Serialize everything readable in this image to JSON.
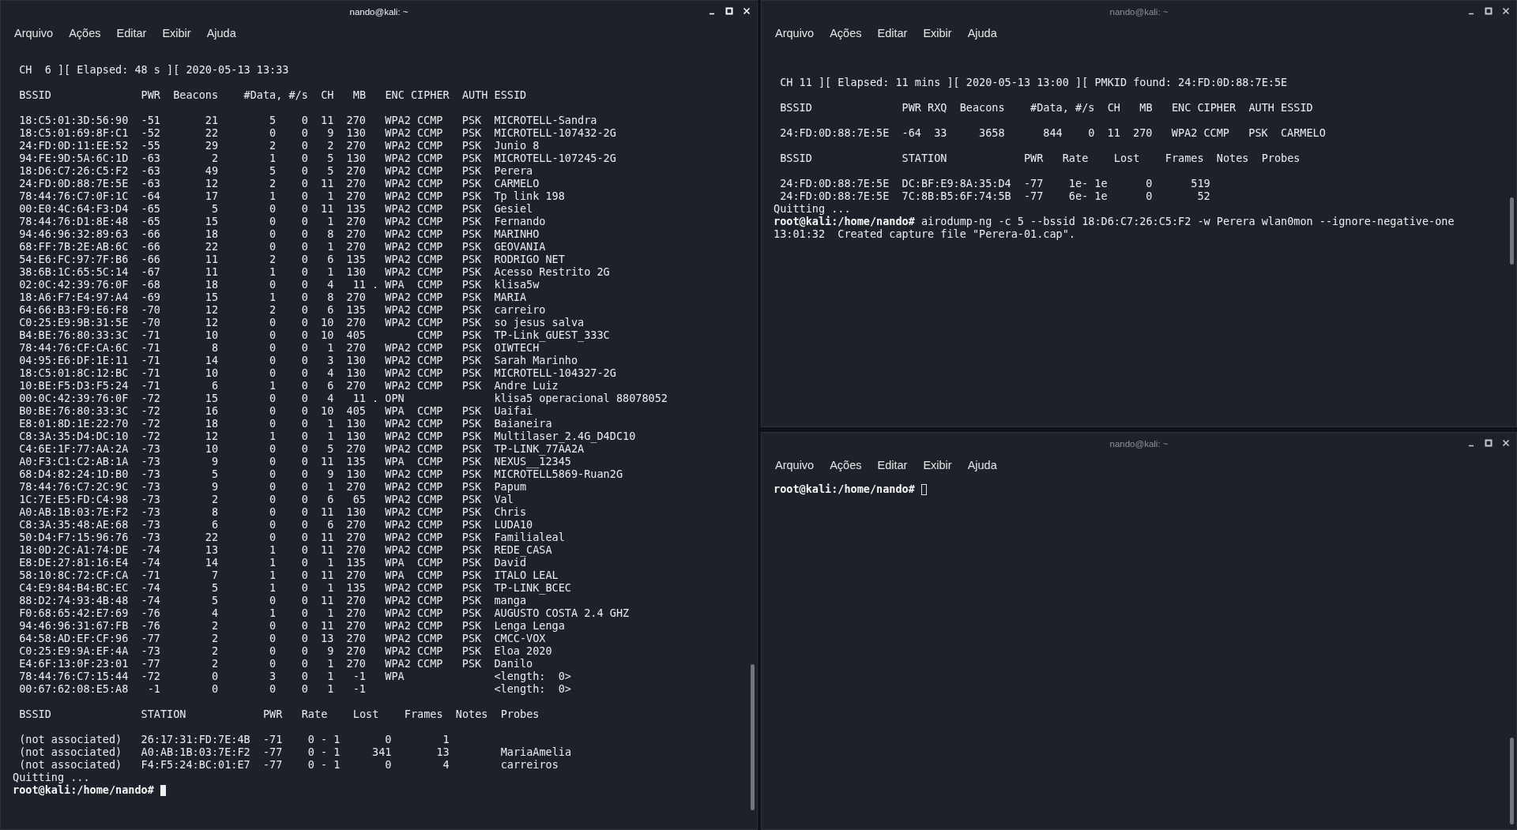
{
  "windows": [
    {
      "title": "nando@kali: ~",
      "focused": true,
      "menu": [
        "Arquivo",
        "Ações",
        "Editar",
        "Exibir",
        "Ajuda"
      ],
      "lines": [
        {
          "kind": "blank"
        },
        {
          "kind": "text",
          "text": " CH  6 ][ Elapsed: 48 s ][ 2020-05-13 13:33"
        },
        {
          "kind": "blank"
        },
        {
          "kind": "text",
          "text": " BSSID              PWR  Beacons    #Data, #/s  CH   MB   ENC CIPHER  AUTH ESSID"
        },
        {
          "kind": "blank"
        },
        {
          "kind": "ap",
          "bssid": "18:C5:01:3D:56:90",
          "pwr": "-51",
          "beacons": "21",
          "data": "5",
          "rate": "0",
          "ch": "11",
          "mb": "270",
          "enc": "WPA2",
          "cipher": "CCMP",
          "auth": "PSK",
          "essid": "MICROTELL-Sandra"
        },
        {
          "kind": "ap",
          "bssid": "18:C5:01:69:8F:C1",
          "pwr": "-52",
          "beacons": "22",
          "data": "0",
          "rate": "0",
          "ch": "9",
          "mb": "130",
          "enc": "WPA2",
          "cipher": "CCMP",
          "auth": "PSK",
          "essid": "MICROTELL-107432-2G"
        },
        {
          "kind": "ap",
          "bssid": "24:FD:0D:11:EE:52",
          "pwr": "-55",
          "beacons": "29",
          "data": "2",
          "rate": "0",
          "ch": "2",
          "mb": "270",
          "enc": "WPA2",
          "cipher": "CCMP",
          "auth": "PSK",
          "essid": "Junio 8"
        },
        {
          "kind": "ap",
          "bssid": "94:FE:9D:5A:6C:1D",
          "pwr": "-63",
          "beacons": "2",
          "data": "1",
          "rate": "0",
          "ch": "5",
          "mb": "130",
          "enc": "WPA2",
          "cipher": "CCMP",
          "auth": "PSK",
          "essid": "MICROTELL-107245-2G"
        },
        {
          "kind": "ap",
          "bssid": "18:D6:C7:26:C5:F2",
          "pwr": "-63",
          "beacons": "49",
          "data": "5",
          "rate": "0",
          "ch": "5",
          "mb": "270",
          "enc": "WPA2",
          "cipher": "CCMP",
          "auth": "PSK",
          "essid": "Perera"
        },
        {
          "kind": "ap",
          "bssid": "24:FD:0D:88:7E:5E",
          "pwr": "-63",
          "beacons": "12",
          "data": "2",
          "rate": "0",
          "ch": "11",
          "mb": "270",
          "enc": "WPA2",
          "cipher": "CCMP",
          "auth": "PSK",
          "essid": "CARMELO"
        },
        {
          "kind": "ap",
          "bssid": "78:44:76:C7:0F:1C",
          "pwr": "-64",
          "beacons": "17",
          "data": "1",
          "rate": "0",
          "ch": "1",
          "mb": "270",
          "enc": "WPA2",
          "cipher": "CCMP",
          "auth": "PSK",
          "essid": "Tp link 198"
        },
        {
          "kind": "ap",
          "bssid": "00:E0:4C:64:F3:D4",
          "pwr": "-65",
          "beacons": "5",
          "data": "0",
          "rate": "0",
          "ch": "11",
          "mb": "135",
          "enc": "WPA2",
          "cipher": "CCMP",
          "auth": "PSK",
          "essid": "Gesiel"
        },
        {
          "kind": "ap",
          "bssid": "78:44:76:D1:8E:48",
          "pwr": "-65",
          "beacons": "15",
          "data": "0",
          "rate": "0",
          "ch": "1",
          "mb": "270",
          "enc": "WPA2",
          "cipher": "CCMP",
          "auth": "PSK",
          "essid": "Fernando"
        },
        {
          "kind": "ap",
          "bssid": "94:46:96:32:89:63",
          "pwr": "-66",
          "beacons": "18",
          "data": "0",
          "rate": "0",
          "ch": "8",
          "mb": "270",
          "enc": "WPA2",
          "cipher": "CCMP",
          "auth": "PSK",
          "essid": "MARINHO"
        },
        {
          "kind": "ap",
          "bssid": "68:FF:7B:2E:AB:6C",
          "pwr": "-66",
          "beacons": "22",
          "data": "0",
          "rate": "0",
          "ch": "1",
          "mb": "270",
          "enc": "WPA2",
          "cipher": "CCMP",
          "auth": "PSK",
          "essid": "GEOVANIA"
        },
        {
          "kind": "ap",
          "bssid": "54:E6:FC:97:7F:B6",
          "pwr": "-66",
          "beacons": "11",
          "data": "2",
          "rate": "0",
          "ch": "6",
          "mb": "135",
          "enc": "WPA2",
          "cipher": "CCMP",
          "auth": "PSK",
          "essid": "RODRIGO NET"
        },
        {
          "kind": "ap",
          "bssid": "38:6B:1C:65:5C:14",
          "pwr": "-67",
          "beacons": "11",
          "data": "1",
          "rate": "0",
          "ch": "1",
          "mb": "130",
          "enc": "WPA2",
          "cipher": "CCMP",
          "auth": "PSK",
          "essid": "Acesso Restrito 2G"
        },
        {
          "kind": "ap",
          "bssid": "02:0C:42:39:76:0F",
          "pwr": "-68",
          "beacons": "18",
          "data": "0",
          "rate": "0",
          "ch": "4",
          "mb": "11",
          "flag": ".",
          "enc": "WPA",
          "cipher": "CCMP",
          "auth": "PSK",
          "essid": "klisa5w"
        },
        {
          "kind": "ap",
          "bssid": "18:A6:F7:E4:97:A4",
          "pwr": "-69",
          "beacons": "15",
          "data": "1",
          "rate": "0",
          "ch": "8",
          "mb": "270",
          "enc": "WPA2",
          "cipher": "CCMP",
          "auth": "PSK",
          "essid": "MARIA"
        },
        {
          "kind": "ap",
          "bssid": "64:66:B3:F9:E6:F8",
          "pwr": "-70",
          "beacons": "12",
          "data": "2",
          "rate": "0",
          "ch": "6",
          "mb": "135",
          "enc": "WPA2",
          "cipher": "CCMP",
          "auth": "PSK",
          "essid": "carreiro"
        },
        {
          "kind": "ap",
          "bssid": "C0:25:E9:9B:31:5E",
          "pwr": "-70",
          "beacons": "12",
          "data": "0",
          "rate": "0",
          "ch": "10",
          "mb": "270",
          "enc": "WPA2",
          "cipher": "CCMP",
          "auth": "PSK",
          "essid": "so jesus salva"
        },
        {
          "kind": "ap",
          "bssid": "B4:BE:76:80:33:3C",
          "pwr": "-71",
          "beacons": "10",
          "data": "0",
          "rate": "0",
          "ch": "10",
          "mb": "405",
          "cipher": "CCMP",
          "auth": "PSK",
          "essid": "TP-Link_GUEST_333C"
        },
        {
          "kind": "ap",
          "bssid": "78:44:76:CF:CA:6C",
          "pwr": "-71",
          "beacons": "8",
          "data": "0",
          "rate": "0",
          "ch": "1",
          "mb": "270",
          "enc": "WPA2",
          "cipher": "CCMP",
          "auth": "PSK",
          "essid": "OIWTECH"
        },
        {
          "kind": "ap",
          "bssid": "04:95:E6:DF:1E:11",
          "pwr": "-71",
          "beacons": "14",
          "data": "0",
          "rate": "0",
          "ch": "3",
          "mb": "130",
          "enc": "WPA2",
          "cipher": "CCMP",
          "auth": "PSK",
          "essid": "Sarah Marinho"
        },
        {
          "kind": "ap",
          "bssid": "18:C5:01:8C:12:BC",
          "pwr": "-71",
          "beacons": "10",
          "data": "0",
          "rate": "0",
          "ch": "4",
          "mb": "130",
          "enc": "WPA2",
          "cipher": "CCMP",
          "auth": "PSK",
          "essid": "MICROTELL-104327-2G"
        },
        {
          "kind": "ap",
          "bssid": "10:BE:F5:D3:F5:24",
          "pwr": "-71",
          "beacons": "6",
          "data": "1",
          "rate": "0",
          "ch": "6",
          "mb": "270",
          "enc": "WPA2",
          "cipher": "CCMP",
          "auth": "PSK",
          "essid": "Andre Luiz"
        },
        {
          "kind": "ap",
          "bssid": "00:0C:42:39:76:0F",
          "pwr": "-72",
          "beacons": "15",
          "data": "0",
          "rate": "0",
          "ch": "4",
          "mb": "11",
          "flag": ".",
          "enc": "OPN",
          "essid": "klisa5 operacional 88078052"
        },
        {
          "kind": "ap",
          "bssid": "B0:BE:76:80:33:3C",
          "pwr": "-72",
          "beacons": "16",
          "data": "0",
          "rate": "0",
          "ch": "10",
          "mb": "405",
          "enc": "WPA",
          "cipher": "CCMP",
          "auth": "PSK",
          "essid": "Uaifai"
        },
        {
          "kind": "ap",
          "bssid": "E8:01:8D:1E:22:70",
          "pwr": "-72",
          "beacons": "18",
          "data": "0",
          "rate": "0",
          "ch": "1",
          "mb": "130",
          "enc": "WPA2",
          "cipher": "CCMP",
          "auth": "PSK",
          "essid": "Baianeira"
        },
        {
          "kind": "ap",
          "bssid": "C8:3A:35:D4:DC:10",
          "pwr": "-72",
          "beacons": "12",
          "data": "1",
          "rate": "0",
          "ch": "1",
          "mb": "130",
          "enc": "WPA2",
          "cipher": "CCMP",
          "auth": "PSK",
          "essid": "Multilaser_2.4G_D4DC10"
        },
        {
          "kind": "ap",
          "bssid": "C4:6E:1F:77:AA:2A",
          "pwr": "-73",
          "beacons": "10",
          "data": "0",
          "rate": "0",
          "ch": "5",
          "mb": "270",
          "enc": "WPA2",
          "cipher": "CCMP",
          "auth": "PSK",
          "essid": "TP-LINK_77AA2A"
        },
        {
          "kind": "ap",
          "bssid": "A0:F3:C1:C2:AB:1A",
          "pwr": "-73",
          "beacons": "9",
          "data": "0",
          "rate": "0",
          "ch": "11",
          "mb": "135",
          "enc": "WPA",
          "cipher": "CCMP",
          "auth": "PSK",
          "essid": "NEXUS__12345"
        },
        {
          "kind": "ap",
          "bssid": "68:D4:82:24:1D:B0",
          "pwr": "-73",
          "beacons": "5",
          "data": "0",
          "rate": "0",
          "ch": "9",
          "mb": "130",
          "enc": "WPA2",
          "cipher": "CCMP",
          "auth": "PSK",
          "essid": "MICROTELL5869-Ruan2G"
        },
        {
          "kind": "ap",
          "bssid": "78:44:76:C7:2C:9C",
          "pwr": "-73",
          "beacons": "9",
          "data": "0",
          "rate": "0",
          "ch": "1",
          "mb": "270",
          "enc": "WPA2",
          "cipher": "CCMP",
          "auth": "PSK",
          "essid": "Papum"
        },
        {
          "kind": "ap",
          "bssid": "1C:7E:E5:FD:C4:98",
          "pwr": "-73",
          "beacons": "2",
          "data": "0",
          "rate": "0",
          "ch": "6",
          "mb": "65",
          "enc": "WPA2",
          "cipher": "CCMP",
          "auth": "PSK",
          "essid": "Val"
        },
        {
          "kind": "ap",
          "bssid": "A0:AB:1B:03:7E:F2",
          "pwr": "-73",
          "beacons": "8",
          "data": "0",
          "rate": "0",
          "ch": "11",
          "mb": "130",
          "enc": "WPA2",
          "cipher": "CCMP",
          "auth": "PSK",
          "essid": "Chris"
        },
        {
          "kind": "ap",
          "bssid": "C8:3A:35:48:AE:68",
          "pwr": "-73",
          "beacons": "6",
          "data": "0",
          "rate": "0",
          "ch": "6",
          "mb": "270",
          "enc": "WPA2",
          "cipher": "CCMP",
          "auth": "PSK",
          "essid": "LUDA10"
        },
        {
          "kind": "ap",
          "bssid": "50:D4:F7:15:96:76",
          "pwr": "-73",
          "beacons": "22",
          "data": "0",
          "rate": "0",
          "ch": "11",
          "mb": "270",
          "enc": "WPA2",
          "cipher": "CCMP",
          "auth": "PSK",
          "essid": "Familialeal"
        },
        {
          "kind": "ap",
          "bssid": "18:0D:2C:A1:74:DE",
          "pwr": "-74",
          "beacons": "13",
          "data": "1",
          "rate": "0",
          "ch": "11",
          "mb": "270",
          "enc": "WPA2",
          "cipher": "CCMP",
          "auth": "PSK",
          "essid": "REDE_CASA"
        },
        {
          "kind": "ap",
          "bssid": "E8:DE:27:81:16:E4",
          "pwr": "-74",
          "beacons": "14",
          "data": "1",
          "rate": "0",
          "ch": "1",
          "mb": "135",
          "enc": "WPA",
          "cipher": "CCMP",
          "auth": "PSK",
          "essid": "David"
        },
        {
          "kind": "ap",
          "bssid": "58:10:8C:72:CF:CA",
          "pwr": "-71",
          "beacons": "7",
          "data": "1",
          "rate": "0",
          "ch": "11",
          "mb": "270",
          "enc": "WPA",
          "cipher": "CCMP",
          "auth": "PSK",
          "essid": "ITALO LEAL"
        },
        {
          "kind": "ap",
          "bssid": "C4:E9:84:B4:BC:EC",
          "pwr": "-74",
          "beacons": "5",
          "data": "1",
          "rate": "0",
          "ch": "1",
          "mb": "135",
          "enc": "WPA2",
          "cipher": "CCMP",
          "auth": "PSK",
          "essid": "TP-LINK_BCEC"
        },
        {
          "kind": "ap",
          "bssid": "88:D2:74:93:4B:48",
          "pwr": "-74",
          "beacons": "5",
          "data": "0",
          "rate": "0",
          "ch": "11",
          "mb": "270",
          "enc": "WPA2",
          "cipher": "CCMP",
          "auth": "PSK",
          "essid": "manga"
        },
        {
          "kind": "ap",
          "bssid": "F0:68:65:42:E7:69",
          "pwr": "-76",
          "beacons": "4",
          "data": "1",
          "rate": "0",
          "ch": "1",
          "mb": "270",
          "enc": "WPA2",
          "cipher": "CCMP",
          "auth": "PSK",
          "essid": "AUGUSTO COSTA 2.4 GHZ"
        },
        {
          "kind": "ap",
          "bssid": "94:46:96:31:67:FB",
          "pwr": "-76",
          "beacons": "2",
          "data": "0",
          "rate": "0",
          "ch": "11",
          "mb": "270",
          "enc": "WPA2",
          "cipher": "CCMP",
          "auth": "PSK",
          "essid": "Lenga Lenga"
        },
        {
          "kind": "ap",
          "bssid": "64:58:AD:EF:CF:96",
          "pwr": "-77",
          "beacons": "2",
          "data": "0",
          "rate": "0",
          "ch": "13",
          "mb": "270",
          "enc": "WPA2",
          "cipher": "CCMP",
          "auth": "PSK",
          "essid": "CMCC-VOX"
        },
        {
          "kind": "ap",
          "bssid": "C0:25:E9:9A:EF:4A",
          "pwr": "-73",
          "beacons": "2",
          "data": "0",
          "rate": "0",
          "ch": "9",
          "mb": "270",
          "enc": "WPA2",
          "cipher": "CCMP",
          "auth": "PSK",
          "essid": "Eloa 2020"
        },
        {
          "kind": "ap",
          "bssid": "E4:6F:13:0F:23:01",
          "pwr": "-77",
          "beacons": "2",
          "data": "0",
          "rate": "0",
          "ch": "1",
          "mb": "270",
          "enc": "WPA2",
          "cipher": "CCMP",
          "auth": "PSK",
          "essid": "Danilo"
        },
        {
          "kind": "ap",
          "bssid": "78:44:76:C7:15:44",
          "pwr": "-72",
          "beacons": "0",
          "data": "3",
          "rate": "0",
          "ch": "1",
          "mb": "-1",
          "enc": "WPA",
          "essid": "<length:  0>"
        },
        {
          "kind": "ap",
          "bssid": "00:67:62:08:E5:A8",
          "pwr": "-1",
          "beacons": "0",
          "data": "0",
          "rate": "0",
          "ch": "1",
          "mb": "-1",
          "essid": "<length:  0>"
        },
        {
          "kind": "blank"
        },
        {
          "kind": "text",
          "text": " BSSID              STATION            PWR   Rate    Lost    Frames  Notes  Probes"
        },
        {
          "kind": "blank"
        },
        {
          "kind": "sta",
          "bssid": "(not associated)",
          "station": "26:17:31:FD:7E:4B",
          "pwr": "-71",
          "rate": "0 - 1",
          "lost": "0",
          "frames": "1"
        },
        {
          "kind": "sta",
          "bssid": "(not associated)",
          "station": "A0:AB:1B:03:7E:F2",
          "pwr": "-77",
          "rate": "0 - 1",
          "lost": "341",
          "frames": "13",
          "probes": "MariaAmelia"
        },
        {
          "kind": "sta",
          "bssid": "(not associated)",
          "station": "F4:F5:24:BC:01:E7",
          "pwr": "-77",
          "rate": "0 - 1",
          "lost": "0",
          "frames": "4",
          "probes": "carreiros"
        },
        {
          "kind": "text",
          "text": "Quitting ..."
        },
        {
          "kind": "prompt",
          "prompt": "root@kali:/home/nando#",
          "cursor": true
        }
      ]
    },
    {
      "title": "nando@kali: ~",
      "focused": false,
      "menu": [
        "Arquivo",
        "Ações",
        "Editar",
        "Exibir",
        "Ajuda"
      ],
      "lines": [
        {
          "kind": "blank"
        },
        {
          "kind": "blank"
        },
        {
          "kind": "text",
          "text": " CH 11 ][ Elapsed: 11 mins ][ 2020-05-13 13:00 ][ PMKID found: 24:FD:0D:88:7E:5E"
        },
        {
          "kind": "blank"
        },
        {
          "kind": "text",
          "text": " BSSID              PWR RXQ  Beacons    #Data, #/s  CH   MB   ENC CIPHER  AUTH ESSID"
        },
        {
          "kind": "blank"
        },
        {
          "kind": "ap_rxq",
          "bssid": "24:FD:0D:88:7E:5E",
          "pwr": "-64",
          "rxq": "33",
          "beacons": "3658",
          "data": "844",
          "rate": "0",
          "ch": "11",
          "mb": "270",
          "enc": "WPA2",
          "cipher": "CCMP",
          "auth": "PSK",
          "essid": "CARMELO"
        },
        {
          "kind": "blank"
        },
        {
          "kind": "text",
          "text": " BSSID              STATION            PWR   Rate    Lost    Frames  Notes  Probes"
        },
        {
          "kind": "blank"
        },
        {
          "kind": "sta",
          "bssid": "24:FD:0D:88:7E:5E",
          "station": "DC:BF:E9:8A:35:D4",
          "pwr": "-77",
          "rate": "1e- 1e",
          "lost": "0",
          "frames": "519"
        },
        {
          "kind": "sta",
          "bssid": "24:FD:0D:88:7E:5E",
          "station": "7C:8B:B5:6F:74:5B",
          "pwr": "-77",
          "rate": "6e- 1e",
          "lost": "0",
          "frames": "52"
        },
        {
          "kind": "text",
          "text": "Quitting ..."
        },
        {
          "kind": "prompt",
          "prompt": "root@kali:/home/nando#",
          "command": "airodump-ng -c 5 --bssid 18:D6:C7:26:C5:F2 -w Perera wlan0mon --ignore-negative-one"
        },
        {
          "kind": "text",
          "text": "13:01:32  Created capture file \"Perera-01.cap\"."
        }
      ]
    },
    {
      "title": "nando@kali: ~",
      "focused": false,
      "menu": [
        "Arquivo",
        "Ações",
        "Editar",
        "Exibir",
        "Ajuda"
      ],
      "lines": [
        {
          "kind": "prompt",
          "prompt": "root@kali:/home/nando#",
          "cursor": true
        }
      ]
    }
  ]
}
